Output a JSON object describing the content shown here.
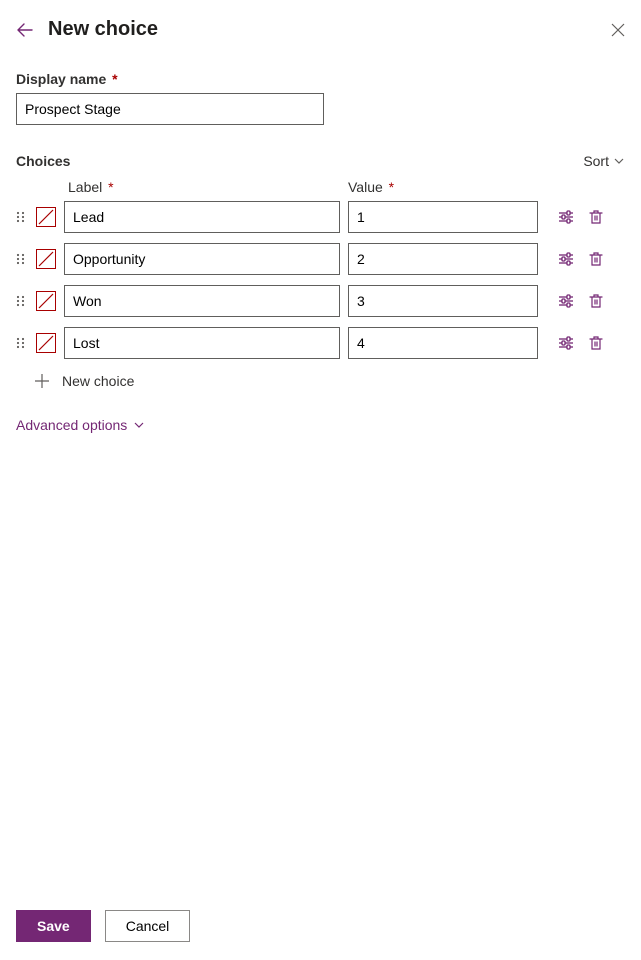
{
  "header": {
    "title": "New choice"
  },
  "displayName": {
    "label": "Display name",
    "value": "Prospect Stage"
  },
  "choices": {
    "sectionTitle": "Choices",
    "sortLabel": "Sort",
    "labelHeader": "Label",
    "valueHeader": "Value",
    "rows": [
      {
        "label": "Lead",
        "value": "1"
      },
      {
        "label": "Opportunity",
        "value": "2"
      },
      {
        "label": "Won",
        "value": "3"
      },
      {
        "label": "Lost",
        "value": "4"
      }
    ],
    "newChoiceLabel": "New choice"
  },
  "advancedOptionsLabel": "Advanced options",
  "footer": {
    "save": "Save",
    "cancel": "Cancel"
  },
  "colors": {
    "accent": "#742774",
    "required": "#a80000"
  }
}
